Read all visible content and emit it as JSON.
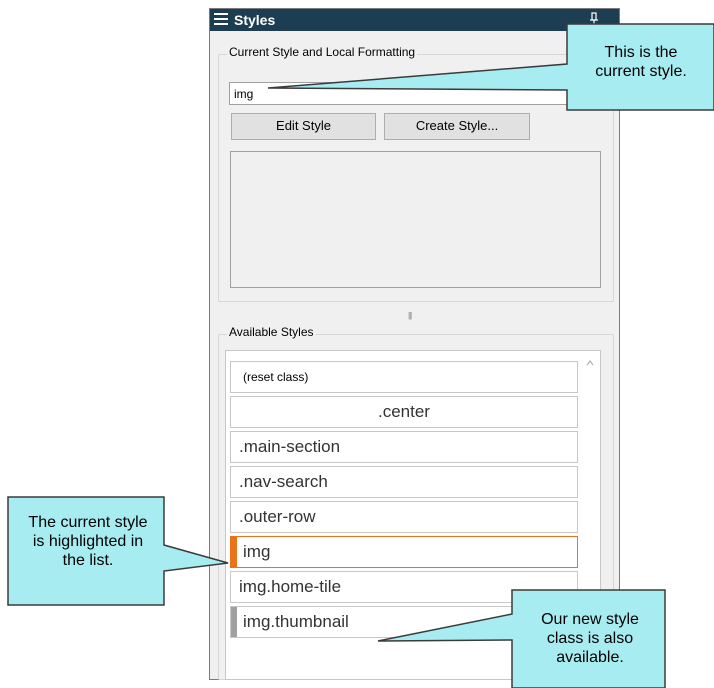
{
  "panel": {
    "title": "Styles",
    "title_icon": "hamburger-icon"
  },
  "current_group": {
    "legend": "Current Style and Local Formatting",
    "style_value": "img",
    "edit_button": "Edit Style",
    "create_button": "Create Style..."
  },
  "available_group": {
    "legend": "Available Styles",
    "items": [
      {
        "label": "(reset class)",
        "selected": false
      },
      {
        "label": ".center",
        "selected": false
      },
      {
        "label": ".main-section",
        "selected": false
      },
      {
        "label": ".nav-search",
        "selected": false
      },
      {
        "label": ".outer-row",
        "selected": false
      },
      {
        "label": "img",
        "selected": true
      },
      {
        "label": "img.home-tile",
        "selected": false
      },
      {
        "label": "img.thumbnail",
        "selected": false
      }
    ]
  },
  "callouts": {
    "current_style": "This is the current style.",
    "highlighted": "The current style is highlighted in the list.",
    "new_class": "Our new style class is also available."
  },
  "colors": {
    "titlebar": "#1d3e52",
    "callout_fill": "#a7ecf1",
    "selection": "#e8731a"
  }
}
